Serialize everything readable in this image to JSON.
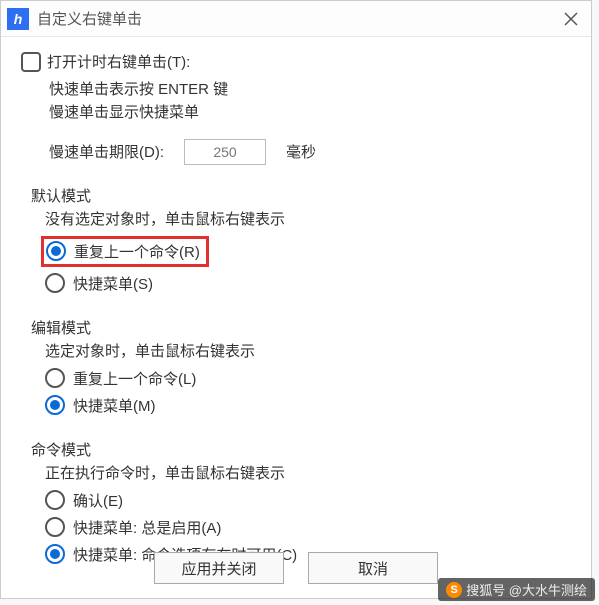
{
  "titlebar": {
    "title": "自定义右键单击"
  },
  "top": {
    "checkbox_label": "打开计时右键单击(T):",
    "line1": "快速单击表示按 ENTER 键",
    "line2": "慢速单击显示快捷菜单",
    "slow_label": "慢速单击期限(D):",
    "slow_value": "250",
    "slow_unit": "毫秒"
  },
  "default_mode": {
    "title": "默认模式",
    "desc": "没有选定对象时，单击鼠标右键表示",
    "opt1": "重复上一个命令(R)",
    "opt2": "快捷菜单(S)"
  },
  "edit_mode": {
    "title": "编辑模式",
    "desc": "选定对象时，单击鼠标右键表示",
    "opt1": "重复上一个命令(L)",
    "opt2": "快捷菜单(M)"
  },
  "cmd_mode": {
    "title": "命令模式",
    "desc": "正在执行命令时，单击鼠标右键表示",
    "opt1": "确认(E)",
    "opt2": "快捷菜单: 总是启用(A)",
    "opt3": "快捷菜单: 命令选项存在时可用(C)"
  },
  "buttons": {
    "apply": "应用并关闭",
    "cancel": "取消"
  },
  "watermark": "搜狐号 @大水牛测绘"
}
